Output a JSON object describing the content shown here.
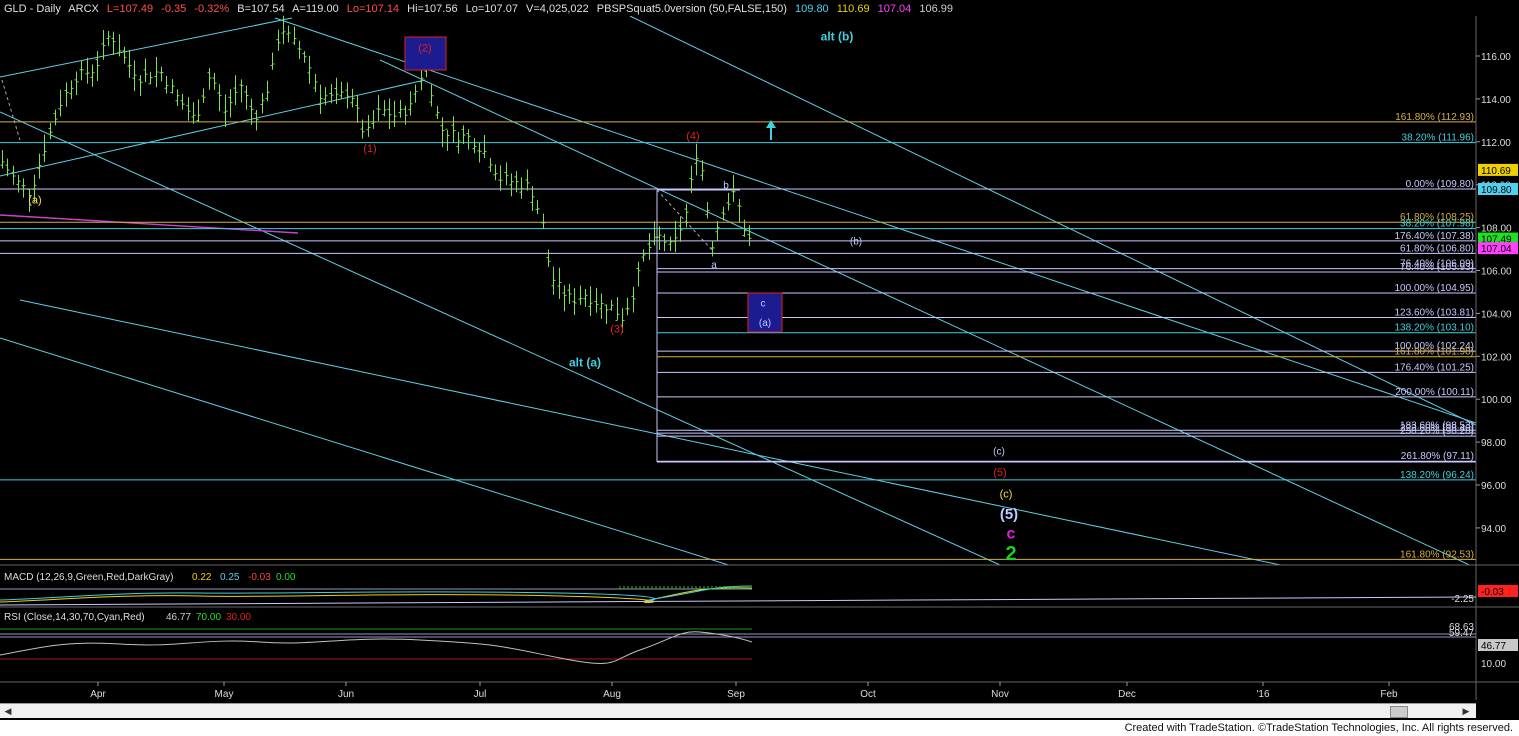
{
  "header": {
    "symbol": "GLD - Daily",
    "exchange": "ARCX",
    "last": "L=107.49",
    "change": "-0.35",
    "change_pct": "-0.32%",
    "bid": "B=107.54",
    "ask": "A=119.00",
    "low": "Lo=107.14",
    "high": "Hi=107.56",
    "low2": "Lo=107.07",
    "volume": "V=4,025,022",
    "study": "PBSPSquat5.0version (50,FALSE,150)",
    "study_values": [
      "109.80",
      "110.69",
      "107.04",
      "106.99"
    ],
    "study_colors": [
      "#4fd2f0",
      "#f0d000",
      "#ff40ff",
      "#cccccc"
    ]
  },
  "colors": {
    "background": "#000000",
    "bars": "#7fe050",
    "channel": "#5ecfe6",
    "fib_white": "#c8c8ff",
    "fib_gold": "#d4b040",
    "wave_red": "#e02020",
    "wave_cyan": "#40d0e0",
    "wave_yellow": "#f0e040",
    "wave_magenta": "#e020e0",
    "wave_green": "#20d020",
    "wave_white": "#c0c8ff"
  },
  "chart_data": [
    {
      "type": "line",
      "name_display": "price",
      "x_axis_labels": [
        "Apr",
        "May",
        "Jun",
        "Jul",
        "Aug",
        "Sep",
        "Oct",
        "Nov",
        "Dec",
        "'16",
        "Feb"
      ],
      "y_ticks": [
        "116.00",
        "114.00",
        "112.00",
        "110.00",
        "108.00",
        "106.00",
        "104.00",
        "102.00",
        "100.00",
        "98.00",
        "96.00",
        "94.00"
      ],
      "ylim": [
        92,
        117.8
      ],
      "price_path": [
        [
          0,
          111.2
        ],
        [
          15,
          110.2
        ],
        [
          30,
          109.6
        ],
        [
          45,
          111.8
        ],
        [
          60,
          113.8
        ],
        [
          75,
          115.0
        ],
        [
          95,
          115.4
        ],
        [
          110,
          117.1
        ],
        [
          125,
          115.8
        ],
        [
          140,
          115.0
        ],
        [
          160,
          115.3
        ],
        [
          175,
          114.2
        ],
        [
          195,
          113.0
        ],
        [
          210,
          115.2
        ],
        [
          225,
          113.4
        ],
        [
          240,
          114.7
        ],
        [
          255,
          113.1
        ],
        [
          270,
          114.8
        ],
        [
          280,
          117.4
        ],
        [
          290,
          116.8
        ],
        [
          305,
          116.0
        ],
        [
          320,
          114.2
        ],
        [
          335,
          114.0
        ],
        [
          350,
          114.4
        ],
        [
          365,
          112.2
        ],
        [
          380,
          113.5
        ],
        [
          395,
          113.2
        ],
        [
          410,
          113.6
        ],
        [
          425,
          115.7
        ],
        [
          440,
          112.6
        ],
        [
          455,
          112.3
        ],
        [
          470,
          112.2
        ],
        [
          485,
          111.5
        ],
        [
          500,
          110.3
        ],
        [
          515,
          110.1
        ],
        [
          530,
          109.9
        ],
        [
          542,
          108.3
        ],
        [
          550,
          105.8
        ],
        [
          560,
          105.1
        ],
        [
          572,
          104.6
        ],
        [
          585,
          104.9
        ],
        [
          600,
          104.4
        ],
        [
          612,
          104.3
        ],
        [
          622,
          103.8
        ],
        [
          632,
          104.8
        ],
        [
          645,
          106.9
        ],
        [
          660,
          107.6
        ],
        [
          672,
          107.0
        ],
        [
          685,
          108.5
        ],
        [
          698,
          111.9
        ],
        [
          705,
          109.5
        ],
        [
          712,
          107.2
        ],
        [
          722,
          108.8
        ],
        [
          735,
          109.6
        ],
        [
          745,
          107.8
        ],
        [
          752,
          107.2
        ]
      ],
      "fib_levels": [
        {
          "label": "161.80% (112.93)",
          "value": 112.93,
          "color": "#d4b040"
        },
        {
          "label": "38.20% (111.96)",
          "value": 111.96,
          "color": "#40d0e0"
        },
        {
          "label": "0.00% (109.80)",
          "value": 109.8,
          "color": "#c8c8ff"
        },
        {
          "label": "61.80% (108.25)",
          "value": 108.25,
          "color": "#d4b040"
        },
        {
          "label": "38.20% (107.98)",
          "value": 107.95,
          "color": "#40d0e0"
        },
        {
          "label": "176.40% (107.38)",
          "value": 107.38,
          "color": "#c8c8ff"
        },
        {
          "label": "61.80% (106.80)",
          "value": 106.8,
          "color": "#c8c8ff"
        },
        {
          "label": "76.40% (106.09)",
          "value": 106.09,
          "color": "#c8c8ff"
        },
        {
          "label": "76.40% (105.93)",
          "value": 105.93,
          "color": "#c8c8ff"
        },
        {
          "label": "100.00% (104.95)",
          "value": 104.95,
          "color": "#c8c8ff"
        },
        {
          "label": "123.60% (103.81)",
          "value": 103.81,
          "color": "#c8c8ff"
        },
        {
          "label": "138.20% (103.10)",
          "value": 103.1,
          "color": "#40d0e0"
        },
        {
          "label": "100.00% (102.24)",
          "value": 102.24,
          "color": "#c8c8ff"
        },
        {
          "label": "161.80% (101.98)",
          "value": 101.98,
          "color": "#d4b040"
        },
        {
          "label": "176.40% (101.25)",
          "value": 101.25,
          "color": "#c8c8ff"
        },
        {
          "label": "200.00% (100.11)",
          "value": 100.11,
          "color": "#c8c8ff"
        },
        {
          "label": "183.60% (98.53)",
          "value": 98.55,
          "color": "#c8c8ff"
        },
        {
          "label": "223.60% (98.40)",
          "value": 98.42,
          "color": "#c8c8ff"
        },
        {
          "label": "238.20% (98.28)",
          "value": 98.28,
          "color": "#c8c8ff"
        },
        {
          "label": "261.80% (97.11)",
          "value": 97.11,
          "color": "#c8c8ff"
        },
        {
          "label": "138.20% (96.24)",
          "value": 96.24,
          "color": "#40d0e0"
        },
        {
          "label": "161.80% (92.53)",
          "value": 92.53,
          "color": "#d4b040"
        }
      ],
      "price_tags": [
        {
          "text": "110.69",
          "value": 110.69,
          "bg": "#f0d000",
          "fg": "#000"
        },
        {
          "text": "109.80",
          "value": 109.8,
          "bg": "#4fd2f0",
          "fg": "#000"
        },
        {
          "text": "107.49",
          "value": 107.49,
          "bg": "#20e020",
          "fg": "#000"
        },
        {
          "text": "107.04",
          "value": 107.04,
          "bg": "#ff40ff",
          "fg": "#000"
        }
      ],
      "wave_labels": [
        {
          "text": "(a)",
          "color": "#f0e040",
          "bar": 35,
          "value": 109.3,
          "size": 11
        },
        {
          "text": "(1)",
          "color": "#e02020",
          "bar": 370,
          "value": 111.7,
          "size": 11
        },
        {
          "text": "(2)",
          "color": "#e02020",
          "bar": 425,
          "value": 116.4,
          "size": 11
        },
        {
          "text": "(3)",
          "color": "#e02020",
          "bar": 617,
          "value": 103.3,
          "size": 11
        },
        {
          "text": "(4)",
          "color": "#e02020",
          "bar": 693,
          "value": 112.3,
          "size": 11
        },
        {
          "text": "alt (b)",
          "color": "#40d0e0",
          "bar": 837,
          "value": 116.9,
          "size": 12
        },
        {
          "text": "alt (a)",
          "color": "#40d0e0",
          "bar": 585,
          "value": 101.7,
          "size": 12
        },
        {
          "text": "b",
          "color": "#c0c8ff",
          "bar": 726,
          "value": 110.0,
          "size": 10
        },
        {
          "text": "a",
          "color": "#c0c8ff",
          "bar": 714,
          "value": 106.3,
          "size": 10
        },
        {
          "text": "(b)",
          "color": "#c0c8ff",
          "bar": 856,
          "value": 107.4,
          "size": 10
        },
        {
          "text": "c",
          "color": "#c0c8ff",
          "bar": 763,
          "value": 104.5,
          "size": 10
        },
        {
          "text": "(a)",
          "color": "#c0c8ff",
          "bar": 765,
          "value": 103.6,
          "size": 10
        },
        {
          "text": "(c)",
          "color": "#c0c8ff",
          "bar": 999,
          "value": 97.6,
          "size": 10
        },
        {
          "text": "(5)",
          "color": "#e02020",
          "bar": 1000,
          "value": 96.6,
          "size": 11
        },
        {
          "text": "(c)",
          "color": "#f0e040",
          "bar": 1006,
          "value": 95.6,
          "size": 11
        },
        {
          "text": "(5)",
          "color": "#c0c8ff",
          "bar": 1009,
          "value": 94.6,
          "size": 15
        },
        {
          "text": "c",
          "color": "#e020e0",
          "bar": 1011,
          "value": 93.7,
          "size": 16
        },
        {
          "text": "2",
          "color": "#20d020",
          "bar": 1011,
          "value": 92.7,
          "size": 20
        }
      ]
    },
    {
      "type": "line",
      "name_display": "MACD",
      "label": "MACD (12,26,9,Green,Red,DarkGray)",
      "values": [
        "0.22",
        "0.25",
        "-0.03",
        "0.00"
      ],
      "value_colors": [
        "#f0d000",
        "#4fd2f0",
        "#ff4040",
        "#20e020"
      ],
      "right_tags": [
        {
          "text": "-0.03",
          "bg": "#ff2020"
        }
      ],
      "right_labels": [
        "-2.25"
      ]
    },
    {
      "type": "line",
      "name_display": "RSI",
      "label": "RSI (Close,14,30,70,Cyan,Red)",
      "values": [
        "46.77",
        "70.00",
        "30.00"
      ],
      "value_colors": [
        "#cccccc",
        "#20e020",
        "#e02020"
      ],
      "right_labels": [
        "68.63",
        "59.47",
        "46.77",
        "10.00"
      ]
    }
  ],
  "footer": {
    "text": "Created with TradeStation. ©TradeStation Technologies, Inc. All rights reserved."
  }
}
